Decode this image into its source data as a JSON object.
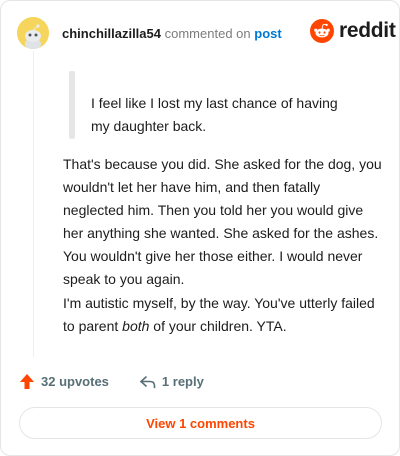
{
  "header": {
    "username": "chinchillazilla54",
    "action_text": "commented on",
    "post_link": "post",
    "logo_text": "reddit"
  },
  "quote": {
    "line1": "I feel like I lost my last chance of having",
    "line2": "my daughter back."
  },
  "comment": {
    "paragraph1": "That's because you did. She asked for the dog, you wouldn't let her have him, and then fatally neglected him. Then you told her you would give her anything she wanted. She asked for the ashes. You wouldn't give her those either. I would never speak to you again.",
    "paragraph2_before": "I'm autistic myself, by the way. You've utterly failed to parent ",
    "paragraph2_emph": "both",
    "paragraph2_after": " of your children. YTA."
  },
  "footer": {
    "upvotes_label": "32 upvotes",
    "reply_label": "1 reply"
  },
  "view_button_label": "View 1 comments",
  "colors": {
    "reddit_orange": "#ff4500",
    "link_blue": "#0079d3",
    "avatar_yellow": "#f6d55c",
    "muted_text": "#7c7c7c"
  },
  "icons": {
    "avatar": "reddit-snoo-avatar",
    "logo": "reddit-snoo-logo",
    "upvote": "upvote-arrow-icon",
    "reply": "reply-arrow-icon"
  }
}
